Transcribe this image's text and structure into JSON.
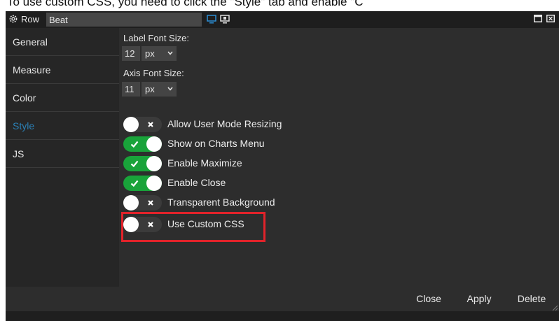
{
  "caption": "To use custom CSS, you need to click the \"Style\" tab and enable \"C",
  "titlebar": {
    "label": "Row",
    "name_value": "Beat",
    "icons": [
      "gear-icon",
      "desktop-view-icon",
      "screen-2-icon",
      "maximize-icon",
      "close-icon"
    ],
    "active_view_color": "#2b8fd6"
  },
  "sidebar": {
    "items": [
      {
        "label": "General",
        "active": false
      },
      {
        "label": "Measure",
        "active": false
      },
      {
        "label": "Color",
        "active": false
      },
      {
        "label": "Style",
        "active": true
      },
      {
        "label": "JS",
        "active": false
      }
    ],
    "active_color": "#2b7fb3"
  },
  "style_panel": {
    "label_font_size": {
      "label": "Label Font Size:",
      "value": "12",
      "unit": "px"
    },
    "axis_font_size": {
      "label": "Axis Font Size:",
      "value": "11",
      "unit": "px"
    },
    "toggles": [
      {
        "label": "Allow User Mode Resizing",
        "on": false
      },
      {
        "label": "Show on Charts Menu",
        "on": true
      },
      {
        "label": "Enable Maximize",
        "on": true
      },
      {
        "label": "Enable Close",
        "on": true
      },
      {
        "label": "Transparent Background",
        "on": false
      },
      {
        "label": "Use Custom CSS",
        "on": false
      }
    ],
    "on_color": "#19a33a",
    "highlight_color": "#e2232a"
  },
  "footer": {
    "close_label": "Close",
    "apply_label": "Apply",
    "delete_label": "Delete"
  }
}
